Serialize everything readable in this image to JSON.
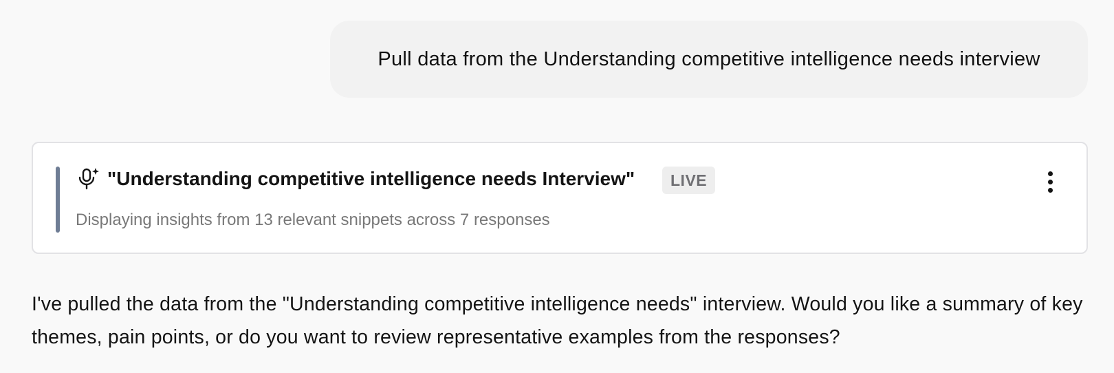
{
  "user_message": {
    "text": "Pull data from the Understanding competitive intelligence needs interview"
  },
  "interview_card": {
    "icon": "microphone-sparkle-icon",
    "title": "\"Understanding competitive intelligence needs Interview\"",
    "badge": "LIVE",
    "subtitle": "Displaying insights from 13 relevant snippets across 7 responses",
    "menu_icon": "vertical-ellipsis-icon",
    "accent_color": "#6f7d95"
  },
  "assistant_message": {
    "text": "I've pulled the data from the \"Understanding competitive intelligence needs\" interview. Would you like a summary of key themes, pain points, or do you want to review representative examples from the responses?"
  }
}
